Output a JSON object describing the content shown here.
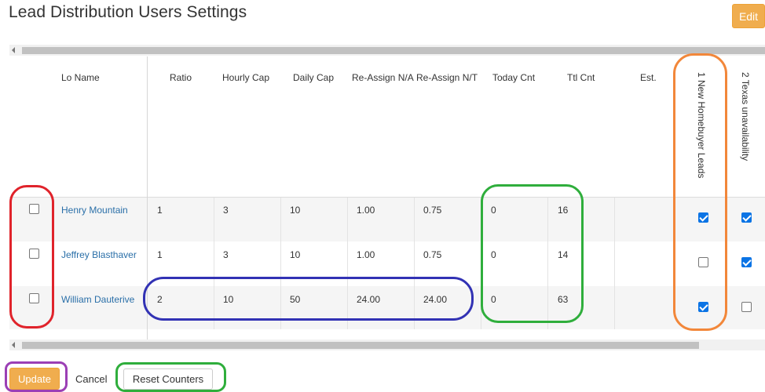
{
  "page": {
    "title": "Lead Distribution Users Settings",
    "edit_label": "Edit"
  },
  "table": {
    "headers": {
      "lo_name": "Lo Name",
      "ratio": "Ratio",
      "hourly_cap": "Hourly Cap",
      "daily_cap": "Daily Cap",
      "reassign_na": "Re-Assign N/A",
      "reassign_nt": "Re-Assign N/T",
      "today_cnt": "Today Cnt",
      "ttl_cnt": "Ttl Cnt",
      "est": "Est.",
      "group1": "1 New Homebuyer Leads",
      "group2": "2 Texas unavailability"
    },
    "rows": [
      {
        "selected": false,
        "name": "Henry Mountain",
        "ratio": "1",
        "hourly_cap": "3",
        "daily_cap": "10",
        "reassign_na": "1.00",
        "reassign_nt": "0.75",
        "today_cnt": "0",
        "ttl_cnt": "16",
        "est": "",
        "group1": true,
        "group2": true
      },
      {
        "selected": false,
        "name": "Jeffrey Blasthaver",
        "ratio": "1",
        "hourly_cap": "3",
        "daily_cap": "10",
        "reassign_na": "1.00",
        "reassign_nt": "0.75",
        "today_cnt": "0",
        "ttl_cnt": "14",
        "est": "",
        "group1": false,
        "group2": true
      },
      {
        "selected": false,
        "name": "William Dauterive",
        "ratio": "2",
        "hourly_cap": "10",
        "daily_cap": "50",
        "reassign_na": "24.00",
        "reassign_nt": "24.00",
        "today_cnt": "0",
        "ttl_cnt": "63",
        "est": "",
        "group1": true,
        "group2": false
      }
    ]
  },
  "footer": {
    "update_label": "Update",
    "cancel_label": "Cancel",
    "reset_label": "Reset Counters"
  },
  "colors": {
    "accent_orange": "#f0ad4e",
    "link_blue": "#2a6fa8",
    "checkbox_blue": "#0b74e5",
    "annotation_red": "#e0232b",
    "annotation_green": "#2fae3c",
    "annotation_blue": "#3232b4",
    "annotation_orange": "#f2873a",
    "annotation_purple": "#9b3fb5"
  }
}
